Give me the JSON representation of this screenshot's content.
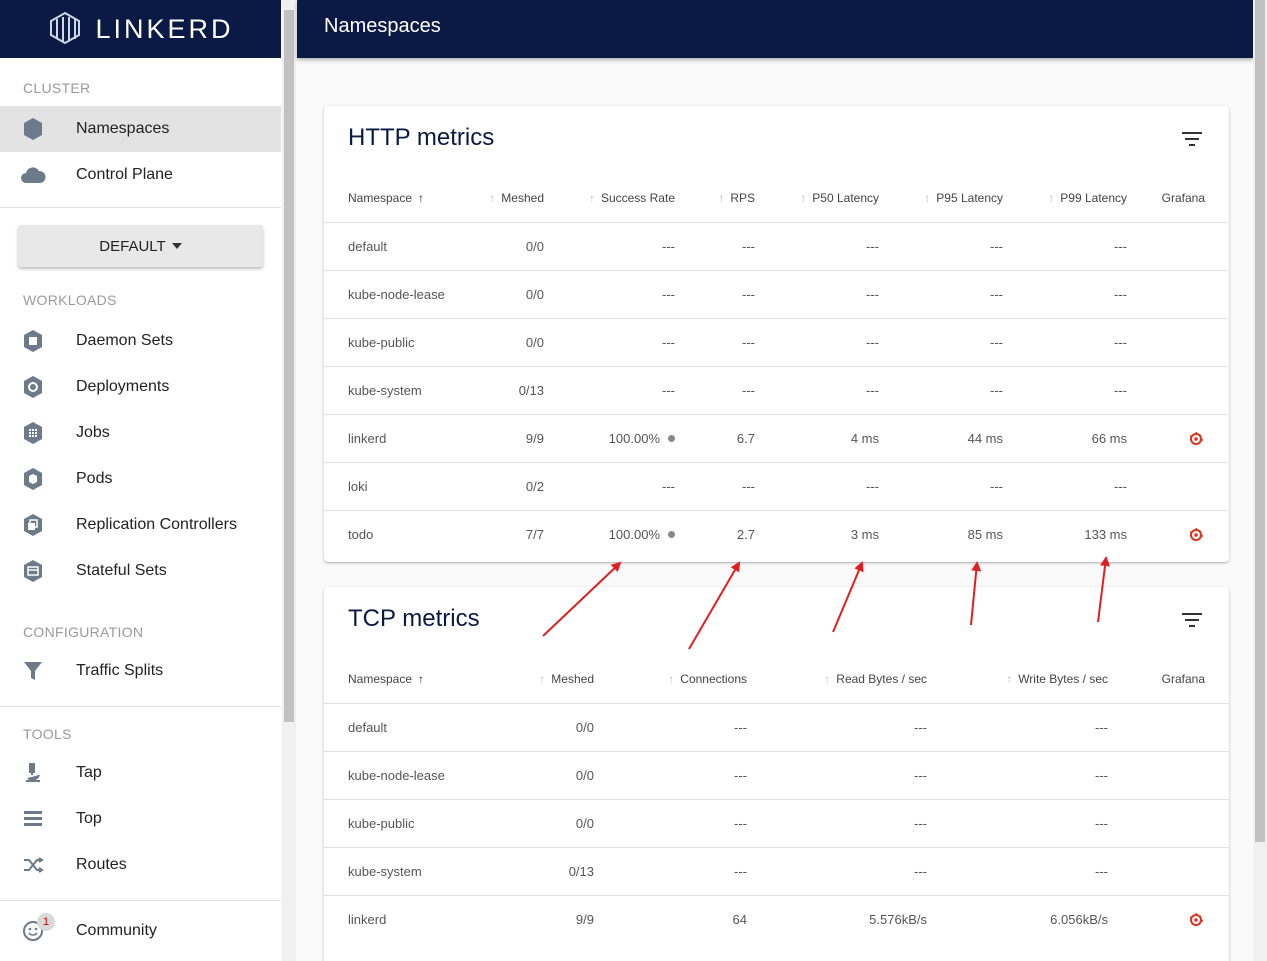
{
  "brand": "LINKERD",
  "page_title": "Namespaces",
  "sidebar": {
    "cluster_label": "CLUSTER",
    "cluster_items": [
      {
        "label": "Namespaces",
        "icon": "namespace-icon",
        "active": true
      },
      {
        "label": "Control Plane",
        "icon": "cloud-icon"
      }
    ],
    "namespace_select": "DEFAULT",
    "workloads_label": "WORKLOADS",
    "workload_items": [
      {
        "label": "Daemon Sets",
        "icon": "daemonset-icon"
      },
      {
        "label": "Deployments",
        "icon": "deployment-icon"
      },
      {
        "label": "Jobs",
        "icon": "job-icon"
      },
      {
        "label": "Pods",
        "icon": "pod-icon"
      },
      {
        "label": "Replication Controllers",
        "icon": "replication-controller-icon"
      },
      {
        "label": "Stateful Sets",
        "icon": "statefulset-icon"
      }
    ],
    "configuration_label": "CONFIGURATION",
    "configuration_items": [
      {
        "label": "Traffic Splits",
        "icon": "filter-funnel-icon"
      }
    ],
    "tools_label": "TOOLS",
    "tools_items": [
      {
        "label": "Tap",
        "icon": "microscope-icon"
      },
      {
        "label": "Top",
        "icon": "list-icon"
      },
      {
        "label": "Routes",
        "icon": "shuffle-icon"
      }
    ],
    "community": {
      "label": "Community",
      "badge": "1",
      "icon": "smiley-icon"
    }
  },
  "http": {
    "title": "HTTP metrics",
    "headers": [
      "Namespace",
      "Meshed",
      "Success Rate",
      "RPS",
      "P50 Latency",
      "P95 Latency",
      "P99 Latency",
      "Grafana"
    ],
    "rows": [
      {
        "ns": "default",
        "meshed": "0/0",
        "sr": "---",
        "rps": "---",
        "p50": "---",
        "p95": "---",
        "p99": "---"
      },
      {
        "ns": "kube-node-lease",
        "meshed": "0/0",
        "sr": "---",
        "rps": "---",
        "p50": "---",
        "p95": "---",
        "p99": "---"
      },
      {
        "ns": "kube-public",
        "meshed": "0/0",
        "sr": "---",
        "rps": "---",
        "p50": "---",
        "p95": "---",
        "p99": "---"
      },
      {
        "ns": "kube-system",
        "meshed": "0/13",
        "sr": "---",
        "rps": "---",
        "p50": "---",
        "p95": "---",
        "p99": "---"
      },
      {
        "ns": "linkerd",
        "meshed": "9/9",
        "sr": "100.00%",
        "rps": "6.7",
        "p50": "4 ms",
        "p95": "44 ms",
        "p99": "66 ms",
        "grafana": true
      },
      {
        "ns": "loki",
        "meshed": "0/2",
        "sr": "---",
        "rps": "---",
        "p50": "---",
        "p95": "---",
        "p99": "---"
      },
      {
        "ns": "todo",
        "meshed": "7/7",
        "sr": "100.00%",
        "rps": "2.7",
        "p50": "3 ms",
        "p95": "85 ms",
        "p99": "133 ms",
        "grafana": true
      }
    ]
  },
  "tcp": {
    "title": "TCP metrics",
    "headers": [
      "Namespace",
      "Meshed",
      "Connections",
      "Read Bytes / sec",
      "Write Bytes / sec",
      "Grafana"
    ],
    "rows": [
      {
        "ns": "default",
        "meshed": "0/0",
        "conn": "---",
        "read": "---",
        "write": "---"
      },
      {
        "ns": "kube-node-lease",
        "meshed": "0/0",
        "conn": "---",
        "read": "---",
        "write": "---"
      },
      {
        "ns": "kube-public",
        "meshed": "0/0",
        "conn": "---",
        "read": "---",
        "write": "---"
      },
      {
        "ns": "kube-system",
        "meshed": "0/13",
        "conn": "---",
        "read": "---",
        "write": "---"
      },
      {
        "ns": "linkerd",
        "meshed": "9/9",
        "conn": "64",
        "read": "5.576kB/s",
        "write": "6.056kB/s",
        "grafana": true
      }
    ]
  },
  "colors": {
    "navy": "#0a1a45",
    "annotation_red": "#e02020",
    "grafana": "#e0301e"
  }
}
